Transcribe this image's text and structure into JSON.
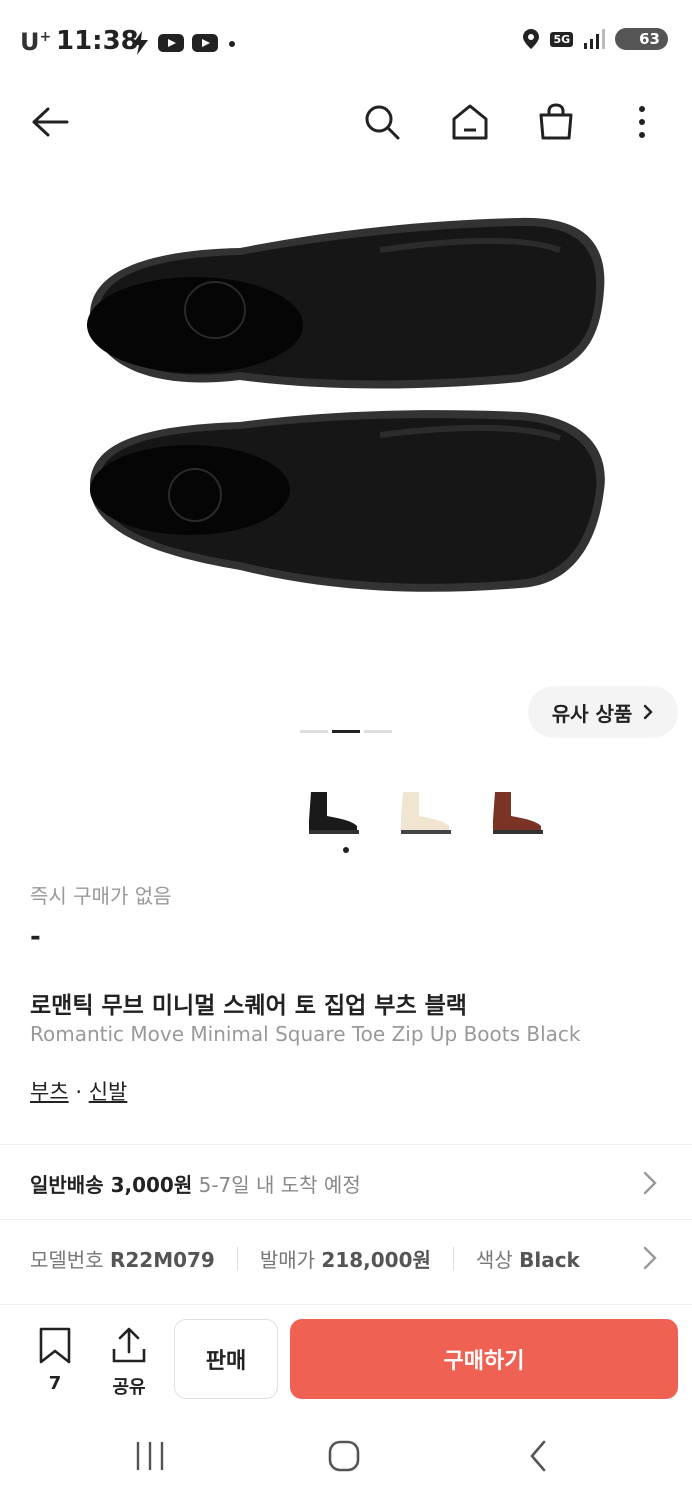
{
  "status_bar": {
    "carrier": "U",
    "carrier_sup": "+",
    "time": "11:38",
    "network": "5G",
    "battery": "63"
  },
  "similar_button": {
    "label": "유사 상품"
  },
  "product": {
    "no_instant_price_label": "즉시 구매가 없음",
    "price": "-",
    "title_ko": "로맨틱 무브 미니멀 스퀘어 토 집업 부츠 블랙",
    "title_en": "Romantic Move Minimal Square Toe Zip Up Boots Black",
    "category_1": "부츠",
    "category_sep": "·",
    "category_2": "신발"
  },
  "shipping": {
    "label": "일반배송 3,000원",
    "eta": "5-7일 내 도착 예정"
  },
  "info": {
    "model_label": "모델번호",
    "model_value": "R22M079",
    "release_label": "발매가",
    "release_value": "218,000원",
    "color_label": "색상",
    "color_value": "Black"
  },
  "bottom_bar": {
    "bookmark_count": "7",
    "share_label": "공유",
    "sell_label": "판매",
    "buy_label": "구매하기"
  },
  "colors": {
    "buy_button": "#EF6253",
    "boot_black": "#1a1a1a",
    "boot_cream": "#efe5d0",
    "boot_brown": "#7a3324"
  },
  "icons": {
    "nav": [
      "back-arrow-icon",
      "search-icon",
      "home-icon",
      "shopping-bag-icon",
      "more-vertical-icon"
    ],
    "thumbnails": [
      "black-boot",
      "cream-boot",
      "brown-boot"
    ]
  },
  "carousel": {
    "page_count": 3,
    "active_page": 2
  }
}
